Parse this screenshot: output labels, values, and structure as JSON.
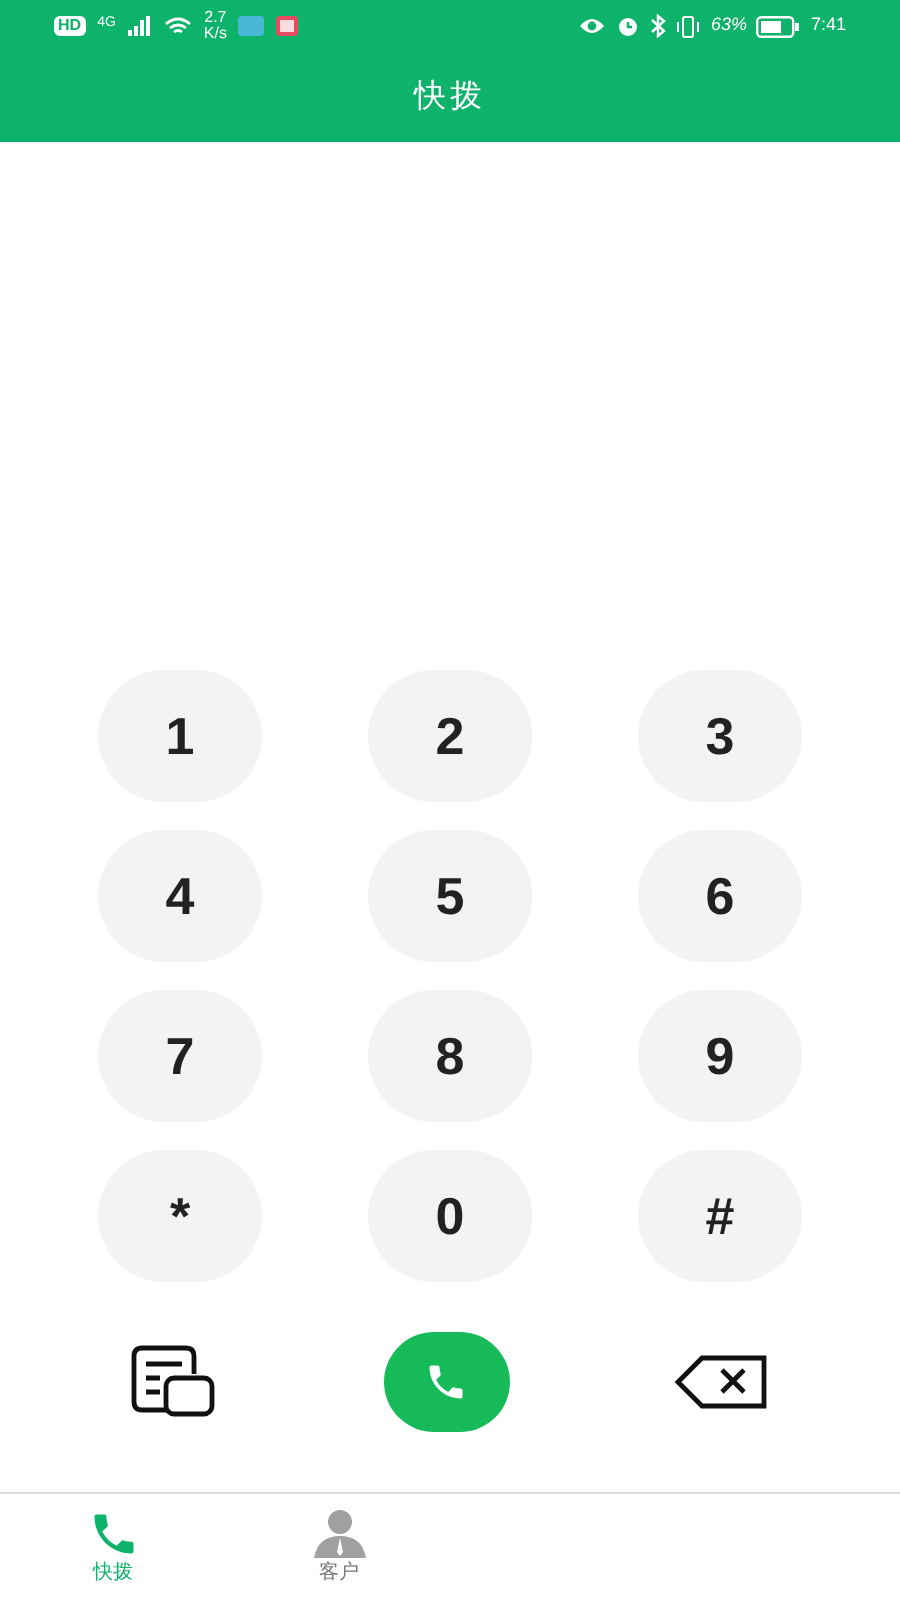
{
  "status_bar": {
    "hd": "HD",
    "network": "4G",
    "speed_value": "2.7",
    "speed_unit": "K/s",
    "battery": "63%",
    "time": "7:41"
  },
  "header": {
    "title": "快拨"
  },
  "keypad": {
    "keys": [
      "1",
      "2",
      "3",
      "4",
      "5",
      "6",
      "7",
      "8",
      "9",
      "*",
      "0",
      "#"
    ]
  },
  "tabs": [
    {
      "label": "快拨",
      "selected": true,
      "kind": "phone"
    },
    {
      "label": "客户",
      "selected": false,
      "kind": "person"
    }
  ]
}
